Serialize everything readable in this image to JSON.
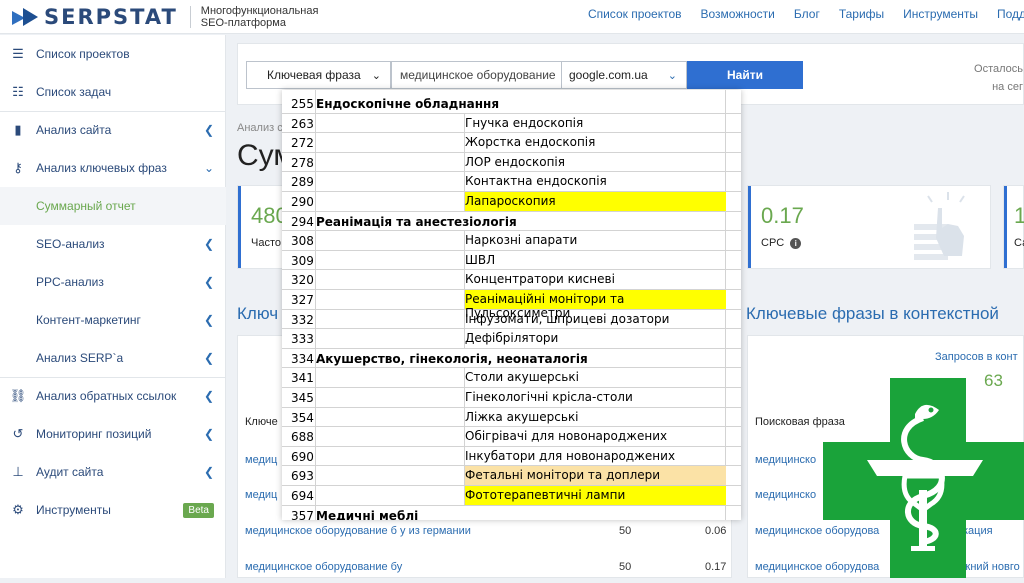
{
  "header": {
    "logo_text": "SERPSTAT",
    "logo_sub1": "Многофункциональная",
    "logo_sub2": "SEO-платформа",
    "nav": [
      "Список проектов",
      "Возможности",
      "Блог",
      "Тарифы",
      "Инструменты",
      "Поддержка"
    ]
  },
  "sidebar": {
    "items": [
      {
        "label": "Список проектов",
        "icon": "menu-icon"
      },
      {
        "label": "Список задач",
        "icon": "list-icon"
      },
      {
        "label": "Анализ сайта",
        "icon": "chart-icon"
      },
      {
        "label": "Анализ ключевых фраз",
        "icon": "key-icon"
      },
      {
        "label": "Суммарный отчет"
      },
      {
        "label": "SEO-анализ"
      },
      {
        "label": "PPC-анализ"
      },
      {
        "label": "Контент-маркетинг"
      },
      {
        "label": "Анализ SERP`a"
      },
      {
        "label": "Анализ обратных ссылок",
        "icon": "link-icon"
      },
      {
        "label": "Мониторинг позиций",
        "icon": "history-icon"
      },
      {
        "label": "Аудит сайта",
        "icon": "sitemap-icon"
      },
      {
        "label": "Инструменты",
        "icon": "gear-icon"
      }
    ],
    "beta": "Beta"
  },
  "search": {
    "type_label": "Ключевая фраза",
    "query_value": "медицинское оборудование",
    "database": "google.com.ua",
    "button": "Найти",
    "remaining_1": "Осталось",
    "remaining_2": "на сег"
  },
  "main": {
    "breadcrumb": "Анализ с",
    "title": "Сум",
    "cards": [
      {
        "value": "480",
        "label": "Часто"
      },
      {
        "value": "0.17",
        "label": "CPC"
      },
      {
        "value": "1",
        "label": "Са"
      }
    ],
    "section_left": "Ключ",
    "section_right": "Ключевые фразы в контекстной",
    "requests_label": "Запросов в конт",
    "requests_value": "63",
    "left_col_header": "Ключе",
    "right_col_header": "Поисковая фраза",
    "rows": [
      {
        "phrase": "медиц",
        "right": "медицинско"
      },
      {
        "phrase": "медиц",
        "right": "медицинско"
      },
      {
        "phrase": "медицинское оборудование б у из германии",
        "count": "50",
        "cpc": "0.06",
        "right": "медицинское оборудова",
        "right_tail": "кация"
      },
      {
        "phrase": "медицинское оборудование бу",
        "count": "50",
        "cpc": "0.17",
        "right": "медицинское оборудова",
        "right_tail": "жний новго"
      }
    ]
  },
  "overlay_table": {
    "rows": [
      {
        "code": "255",
        "category": "Ендоскопічне обладнання"
      },
      {
        "code": "263",
        "name": "Гнучка ендоскопія"
      },
      {
        "code": "272",
        "name": "Жорстка ендоскопія"
      },
      {
        "code": "278",
        "name": "ЛОР ендоскопія"
      },
      {
        "code": "289",
        "name": "Контактна ендоскопія"
      },
      {
        "code": "290",
        "name": "Лапароскопия",
        "highlight": "yellow"
      },
      {
        "code": "294",
        "category": "Реанімація та анестезіологія"
      },
      {
        "code": "308",
        "name": "Наркозні апарати"
      },
      {
        "code": "309",
        "name": "ШВЛ"
      },
      {
        "code": "320",
        "name": "Концентратори кисневі"
      },
      {
        "code": "327",
        "name": "Реанімаційні монітори та Пульсоксиметри",
        "highlight": "yellow"
      },
      {
        "code": "332",
        "name": "Інфузомати, шприцеві дозатори"
      },
      {
        "code": "333",
        "name": "Дефібрілятори"
      },
      {
        "code": "334",
        "category": "Акушерство, гінекологія, неонаталогія"
      },
      {
        "code": "341",
        "name": "Столи акушерські"
      },
      {
        "code": "345",
        "name": "Гінекологічні крісла-столи"
      },
      {
        "code": "354",
        "name": "Ліжка акушерські"
      },
      {
        "code": "688",
        "name": "Обігрівачі для новонароджених"
      },
      {
        "code": "690",
        "name": "Інкубатори для новонароджених"
      },
      {
        "code": "693",
        "name": "Фетальні монітори та доплери",
        "highlight": "orange"
      },
      {
        "code": "694",
        "name": "Фототерапевтичні лампи",
        "highlight": "yellow"
      },
      {
        "code": "357",
        "category": "Медичні меблі"
      }
    ]
  },
  "colors": {
    "accent_blue": "#2f6fd1",
    "accent_green": "#6aa84f",
    "cross_green": "#1aa33a",
    "highlight_yellow": "#ffff00",
    "highlight_orange": "#fbe2a6"
  }
}
